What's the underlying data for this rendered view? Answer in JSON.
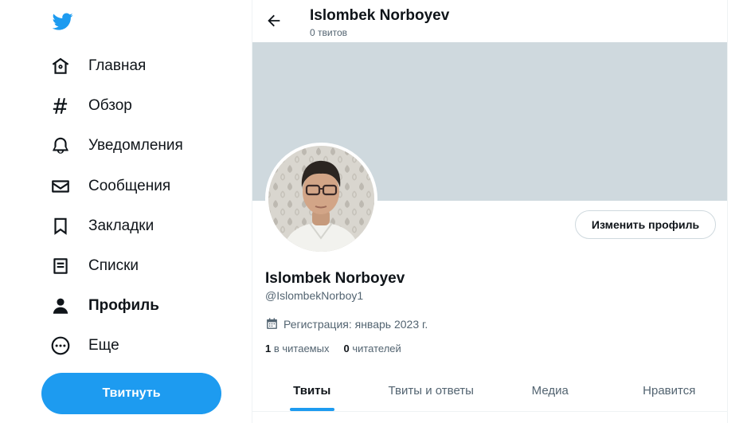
{
  "colors": {
    "accent": "#1d9bf0",
    "banner": "#cfd9de",
    "text": "#0f1419",
    "muted": "#536471"
  },
  "sidebar": {
    "logo_icon": "twitter-bird-icon",
    "items": [
      {
        "label": "Главная",
        "icon": "home-icon"
      },
      {
        "label": "Обзор",
        "icon": "hashtag-icon"
      },
      {
        "label": "Уведомления",
        "icon": "bell-icon"
      },
      {
        "label": "Сообщения",
        "icon": "envelope-icon"
      },
      {
        "label": "Закладки",
        "icon": "bookmark-icon"
      },
      {
        "label": "Списки",
        "icon": "list-icon"
      },
      {
        "label": "Профиль",
        "icon": "person-icon",
        "active": true
      },
      {
        "label": "Еще",
        "icon": "more-circle-icon"
      }
    ],
    "tweet_button": "Твитнуть"
  },
  "header": {
    "name": "Islombek Norboyev",
    "tweet_count": "0 твитов",
    "back_icon": "arrow-left-icon"
  },
  "profile": {
    "display_name": "Islombek Norboyev",
    "handle": "@IslombekNorboy1",
    "joined": "Регистрация: январь 2023 г.",
    "joined_icon": "calendar-icon",
    "following_count": "1",
    "following_label": "в читаемых",
    "followers_count": "0",
    "followers_label": "читателей",
    "edit_button": "Изменить профиль"
  },
  "tabs": [
    {
      "label": "Твиты",
      "active": true
    },
    {
      "label": "Твиты и ответы"
    },
    {
      "label": "Медиа"
    },
    {
      "label": "Нравится"
    }
  ]
}
